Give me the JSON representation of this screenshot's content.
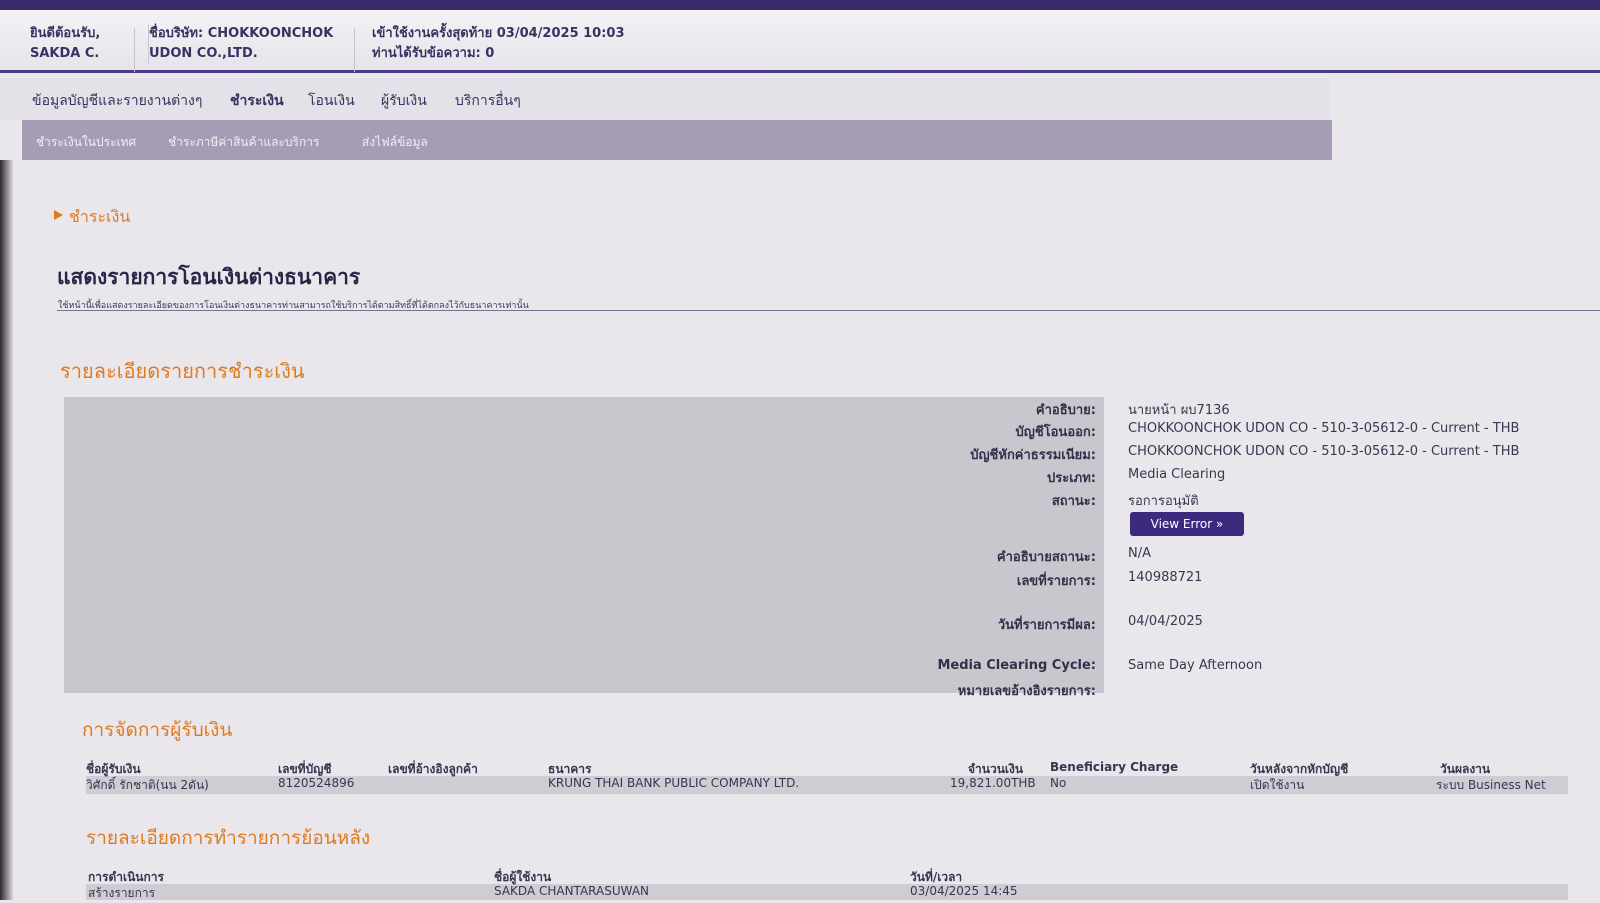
{
  "header": {
    "welcome_line1": "ยินดีต้อนรับ,",
    "welcome_line2": "SAKDA C.",
    "company_line1": "ชื่อบริษัท: CHOKKOONCHOK",
    "company_line2": "UDON CO.,LTD.",
    "last_login": "เข้าใช้งานครั้งสุดท้าย   03/04/2025 10:03",
    "messages": "ท่านได้รับข้อความ: 0"
  },
  "main_nav": [
    "ข้อมูลบัญชีและรายงานต่างๆ",
    "ชำระเงิน",
    "โอนเงิน",
    "ผู้รับเงิน",
    "บริการอื่นๆ"
  ],
  "sub_nav": [
    "ชำระเงินในประเทศ",
    "ชำระภาษีค่าสินค้าและบริการ",
    "ส่งไฟล์ข้อมูล"
  ],
  "breadcrumb": "ชำระเงิน",
  "page_title": "แสดงรายการโอนเงินต่างธนาคาร",
  "page_subtitle": "ใช้หน้านี้เพื่อแสดงรายละเอียดของการโอนเงินต่างธนาคารท่านสามารถใช้บริการได้ตามสิทธิ์ที่ได้ตกลงไว้กับธนาคารเท่านั้น",
  "section_payment_details": "รายละเอียดรายการชำระเงิน",
  "details": [
    {
      "label": "คำอธิบาย:",
      "value": "นายหน้า ผบ7136"
    },
    {
      "label": "บัญชีโอนออก:",
      "value": "CHOKKOONCHOK UDON CO - 510-3-05612-0 - Current - THB"
    },
    {
      "label": "บัญชีหักค่าธรรมเนียม:",
      "value": "CHOKKOONCHOK UDON CO - 510-3-05612-0 - Current - THB"
    },
    {
      "label": "ประเภท:",
      "value": "Media Clearing"
    },
    {
      "label": "สถานะ:",
      "value": "รอการอนุมัติ"
    },
    {
      "label": "คำอธิบายสถานะ:",
      "value": "N/A"
    },
    {
      "label": "เลขที่รายการ:",
      "value": "140988721"
    },
    {
      "label": "วันที่รายการมีผล:",
      "value": "04/04/2025"
    },
    {
      "label": "Media Clearing Cycle:",
      "value": "Same Day Afternoon"
    },
    {
      "label": "หมายเลขอ้างอิงรายการ:",
      "value": ""
    }
  ],
  "view_error_label": "View Error »",
  "section_payees": "การจัดการผู้รับเงิน",
  "payee_headers": [
    "ชื่อผู้รับเงิน",
    "เลขที่บัญชี",
    "เลขที่อ้างอิงลูกค้า",
    "ธนาคาร",
    "จำนวนเงิน",
    "Beneficiary Charge",
    "วันหลังจากหักบัญชี",
    "วันผลงาน"
  ],
  "payee_row": [
    "วิศักดิ์ รักชาติ(นน 2ดัน)",
    "8120524896",
    "",
    "KRUNG THAI BANK PUBLIC COMPANY LTD.",
    "19,821.00THB",
    "No",
    "เปิดใช้งาน",
    "ระบบ Business Net"
  ],
  "section_history": "รายละเอียดการทำรายการย้อนหลัง",
  "history_headers": [
    "การดำเนินการ",
    "ชื่อผู้ใช้งาน",
    "วันที่/เวลา"
  ],
  "history_row": [
    "สร้างรายการ",
    "SAKDA CHANTARASUWAN",
    "03/04/2025 14:45"
  ]
}
